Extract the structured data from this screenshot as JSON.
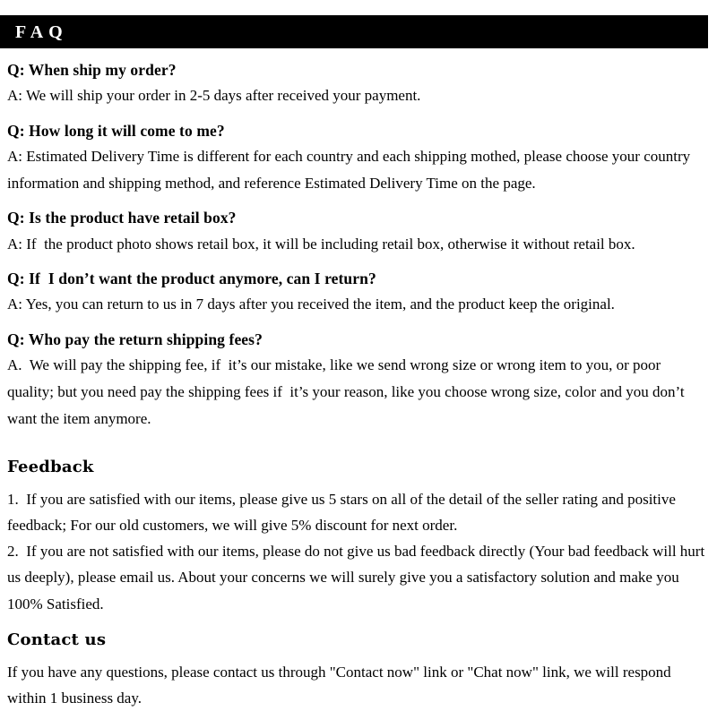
{
  "header": {
    "title": "FAQ"
  },
  "faq": {
    "items": [
      {
        "question": "Q: When ship my order?",
        "answer": "A: We will ship your order in 2-5 days after received your payment."
      },
      {
        "question": "Q: How long it will come to me?",
        "answer": "A: Estimated Delivery Time is different for each country and each shipping mothed, please choose your country information and shipping method, and reference Estimated Delivery Time on the page."
      },
      {
        "question": "Q: Is the product have retail box?",
        "answer": "A: If  the product photo shows retail box, it will be including retail box, otherwise it without retail box."
      },
      {
        "question": "Q: If  I don’t want the product anymore, can I return?",
        "answer": "A: Yes, you can return to us in 7 days after you received the item, and the product keep the original."
      },
      {
        "question": "Q: Who pay the return shipping fees?",
        "answer": "A.  We will pay the shipping fee, if  it’s our mistake, like we send wrong size or wrong item to you, or poor quality; but you need pay the shipping fees if  it’s your reason, like you choose wrong size, color and you don’t want the item anymore."
      }
    ]
  },
  "feedback": {
    "title": "Feedback",
    "point_1": "1.  If you are satisfied with our items, please give us 5 stars on all of the detail of the seller rating and positive feedback; For our old customers, we will give 5% discount for next order.",
    "point_2": "2.  If you are not satisfied with our items, please do not give us bad feedback directly (Your bad feedback will hurt us deeply), please email us. About your concerns we will surely give you a satisfactory solution and make you 100% Satisfied."
  },
  "contact": {
    "title": "Contact us",
    "body": "If you have any questions, please contact us through \"Contact now\" link or \"Chat now\" link, we will respond within 1 business day."
  }
}
